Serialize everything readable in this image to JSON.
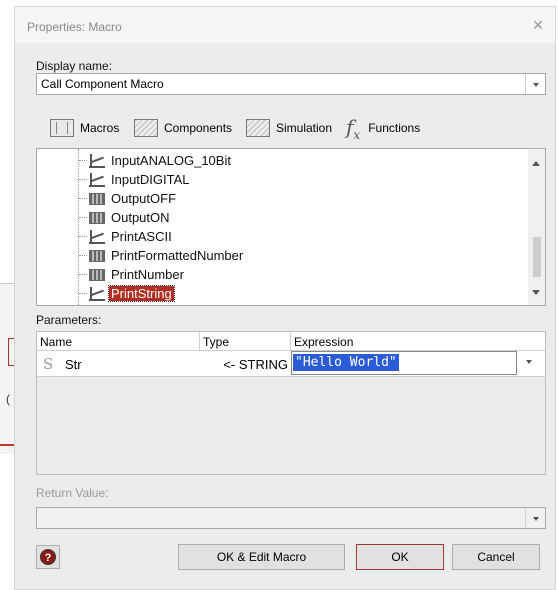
{
  "dialog": {
    "title": "Properties: Macro",
    "close_symbol": "✕"
  },
  "display_name": {
    "label": "Display name:",
    "value": "Call Component Macro"
  },
  "tabs": [
    {
      "label": "Macros",
      "icon": "macros-icon"
    },
    {
      "label": "Components",
      "icon": "components-icon"
    },
    {
      "label": "Simulation",
      "icon": "simulation-icon"
    },
    {
      "label": "Functions",
      "icon": "functions-fx-icon"
    }
  ],
  "tree": {
    "items": [
      {
        "label": "InputANALOG_10Bit",
        "icon": "macro-icon",
        "selected": false
      },
      {
        "label": "InputDIGITAL",
        "icon": "macro-icon",
        "selected": false
      },
      {
        "label": "OutputOFF",
        "icon": "block-icon",
        "selected": false
      },
      {
        "label": "OutputON",
        "icon": "block-icon",
        "selected": false
      },
      {
        "label": "PrintASCII",
        "icon": "macro-icon",
        "selected": false
      },
      {
        "label": "PrintFormattedNumber",
        "icon": "block-icon",
        "selected": false
      },
      {
        "label": "PrintNumber",
        "icon": "block-icon",
        "selected": false
      },
      {
        "label": "PrintString",
        "icon": "macro-icon",
        "selected": true
      }
    ]
  },
  "parameters": {
    "label": "Parameters:",
    "headers": {
      "name": "Name",
      "type": "Type",
      "expression": "Expression"
    },
    "rows": [
      {
        "name": "Str",
        "type": "<- STRING",
        "expression": "\"Hello World\"",
        "icon": "string-s-icon"
      }
    ]
  },
  "return_value": {
    "label": "Return Value:",
    "value": ""
  },
  "buttons": {
    "help": "?",
    "ok_edit": "OK & Edit Macro",
    "ok": "OK",
    "cancel": "Cancel"
  },
  "colors": {
    "selection": "#b22d22",
    "expression_highlight": "#2b5bd7",
    "accent_border": "#a23a34"
  }
}
